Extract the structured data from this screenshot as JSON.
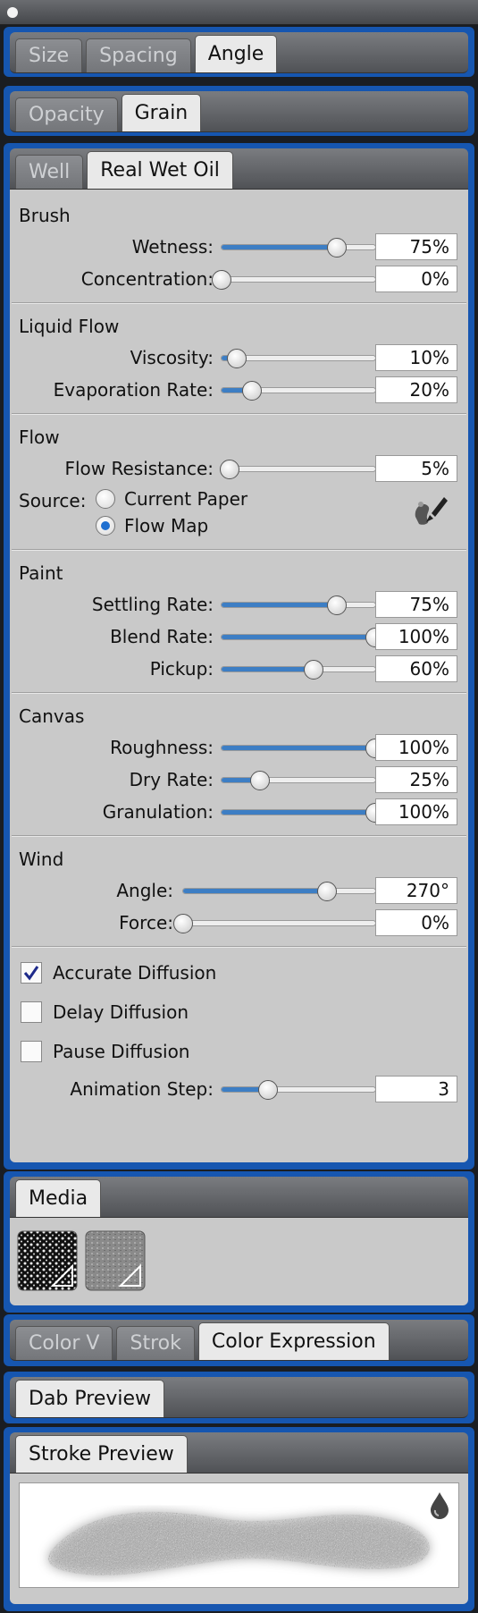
{
  "tabs1": [
    "Size",
    "Spacing",
    "Angle"
  ],
  "tabs2": [
    "Opacity",
    "Grain"
  ],
  "tabs3": [
    "Well",
    "Real Wet Oil"
  ],
  "sections": {
    "brush": {
      "title": "Brush",
      "wetness_label": "Wetness:",
      "wetness": "75%",
      "concentration_label": "Concentration:",
      "concentration": "0%"
    },
    "liquid": {
      "title": "Liquid Flow",
      "viscosity_label": "Viscosity:",
      "viscosity": "10%",
      "evaporation_label": "Evaporation Rate:",
      "evaporation": "20%"
    },
    "flow": {
      "title": "Flow",
      "resistance_label": "Flow Resistance:",
      "resistance": "5%",
      "source_label": "Source:",
      "option1": "Current Paper",
      "option2": "Flow Map",
      "selected": "Flow Map"
    },
    "paint": {
      "title": "Paint",
      "settling_label": "Settling Rate:",
      "settling": "75%",
      "blend_label": "Blend Rate:",
      "blend": "100%",
      "pickup_label": "Pickup:",
      "pickup": "60%"
    },
    "canvas": {
      "title": "Canvas",
      "roughness_label": "Roughness:",
      "roughness": "100%",
      "dry_label": "Dry Rate:",
      "dry": "25%",
      "granulation_label": "Granulation:",
      "granulation": "100%"
    },
    "wind": {
      "title": "Wind",
      "angle_label": "Angle:",
      "angle": "270°",
      "force_label": "Force:",
      "force": "0%"
    }
  },
  "checks": {
    "accurate": "Accurate Diffusion",
    "delay": "Delay Diffusion",
    "pause": "Pause Diffusion",
    "accurate_checked": true,
    "delay_checked": false,
    "pause_checked": false
  },
  "animation": {
    "label": "Animation Step:",
    "value": "3"
  },
  "media": {
    "tab": "Media"
  },
  "tabs4": [
    "Color V",
    "Strok",
    "Color Expression"
  ],
  "dab": {
    "tab": "Dab Preview"
  },
  "stroke": {
    "tab": "Stroke Preview"
  },
  "levels": {
    "wetness": 0.75,
    "concentration": 0,
    "viscosity": 0.1,
    "evaporation": 0.2,
    "resistance": 0.05,
    "settling": 0.75,
    "blend": 1,
    "pickup": 0.6,
    "roughness": 1,
    "dry": 0.25,
    "granulation": 1,
    "angle": 0.75,
    "force": 0,
    "animation": 0.3
  },
  "colors": {
    "accent": "#3d7ec4",
    "panel": "#1656b0",
    "body": "#c9c9c9"
  }
}
